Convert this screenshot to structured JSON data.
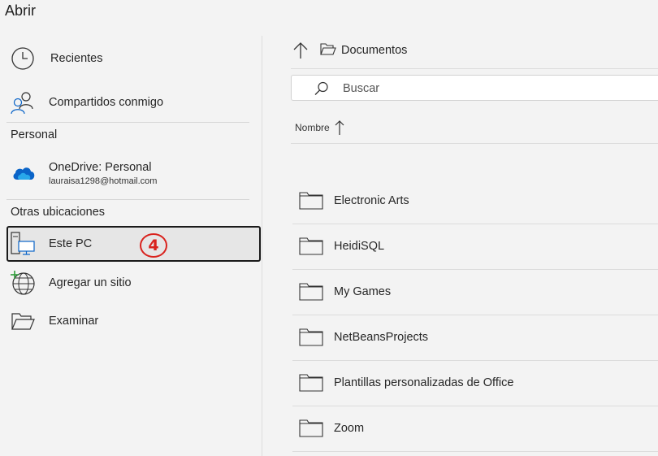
{
  "dialog": {
    "title": "Abrir"
  },
  "sidebar": {
    "items": [
      {
        "label": "Recientes",
        "icon": "clock-icon"
      },
      {
        "label": "Compartidos conmigo",
        "icon": "people-icon"
      }
    ],
    "personal_section": "Personal",
    "onedrive": {
      "label": "OneDrive: Personal",
      "account": "lauraisa1298@hotmail.com",
      "icon": "onedrive-cloud-icon"
    },
    "other_section": "Otras ubicaciones",
    "other_items": [
      {
        "label": "Este PC",
        "icon": "computer-icon",
        "selected": true
      },
      {
        "label": "Agregar un sitio",
        "icon": "globe-add-icon"
      },
      {
        "label": "Examinar",
        "icon": "folder-open-icon"
      }
    ],
    "annotation_badge": "4"
  },
  "location": {
    "current_folder": "Documentos"
  },
  "search": {
    "placeholder": "Buscar"
  },
  "file_list": {
    "column_header": "Nombre",
    "sort": "ascending",
    "folders": [
      "Electronic Arts",
      "HeidiSQL",
      "My Games",
      "NetBeansProjects",
      "Plantillas personalizadas de Office",
      "Zoom"
    ]
  },
  "colors": {
    "background": "#f3f3f3",
    "selected_bg": "#e6e6e6",
    "badge": "#d9231e",
    "onedrive_blue": "#0a64c8"
  }
}
